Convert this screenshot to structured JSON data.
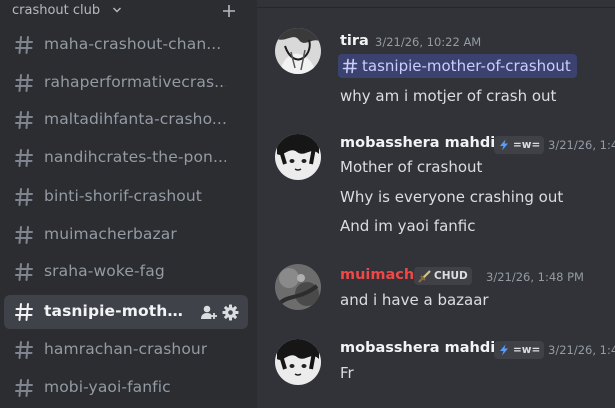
{
  "server": {
    "name": "crashout club"
  },
  "channels": [
    {
      "label": "maha-crashout-chan..."
    },
    {
      "label": "rahaperformativecras..."
    },
    {
      "label": "maltadihfanta-crasho..."
    },
    {
      "label": "nandihcrates-the-pon..."
    },
    {
      "label": "binti-shorif-crashout"
    },
    {
      "label": "muimacherbazar"
    },
    {
      "label": "sraha-woke-fag"
    },
    {
      "label": "tasnipie-mother...",
      "active": true
    },
    {
      "label": "hamrachan-crashour"
    },
    {
      "label": "mobi-yaoi-fanfic"
    }
  ],
  "icons": {
    "server_menu": "chevron-down-icon",
    "create_channel": "plus-icon",
    "channel": "hash-icon",
    "invite": "add-member-icon",
    "settings": "gear-icon"
  },
  "colors": {
    "sidebar_bg": "#2b2d31",
    "chat_bg": "#313338",
    "active_channel": "#404249",
    "mention_bg": "#3c4270",
    "mention_text": "#c9cdfb",
    "muimach_name": "#f04747",
    "tag_blue": "#5b9cff"
  },
  "messages": [
    {
      "author": "tira",
      "timestamp": "3/21/26, 10:22 AM",
      "mention": "tasnipie-mother-of-crashout",
      "lines": [
        "why am i motjer of crash out"
      ]
    },
    {
      "author": "mobasshera mahdi",
      "tag": "=w=",
      "timestamp": "3/21/26, 1:4",
      "lines": [
        "Mother of crashout",
        "Why is everyone crashing out",
        "And im yaoi fanfic"
      ]
    },
    {
      "author": "muimach",
      "tag": "CHUD",
      "timestamp": "3/21/26, 1:48 PM",
      "lines": [
        "and i have a bazaar"
      ]
    },
    {
      "author": "mobasshera mahdi",
      "tag": "=w=",
      "timestamp": "3/21/26, 1:4",
      "lines": [
        "Fr"
      ]
    }
  ]
}
